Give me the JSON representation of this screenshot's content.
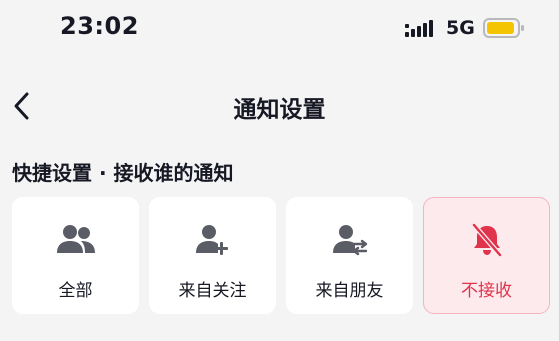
{
  "status_bar": {
    "time": "23:02",
    "network": "5G",
    "battery_color": "#f5c400"
  },
  "nav": {
    "title": "通知设置"
  },
  "section": {
    "title": "快捷设置 · 接收谁的通知"
  },
  "options": [
    {
      "label": "全部",
      "icon": "users-icon",
      "selected": false
    },
    {
      "label": "来自关注",
      "icon": "user-plus-icon",
      "selected": false
    },
    {
      "label": "来自朋友",
      "icon": "user-exchange-icon",
      "selected": false
    },
    {
      "label": "不接收",
      "icon": "bell-off-icon",
      "selected": true
    }
  ],
  "colors": {
    "accent": "#e0334c",
    "selected_bg": "#fdeaed",
    "icon": "#5b5d66"
  }
}
